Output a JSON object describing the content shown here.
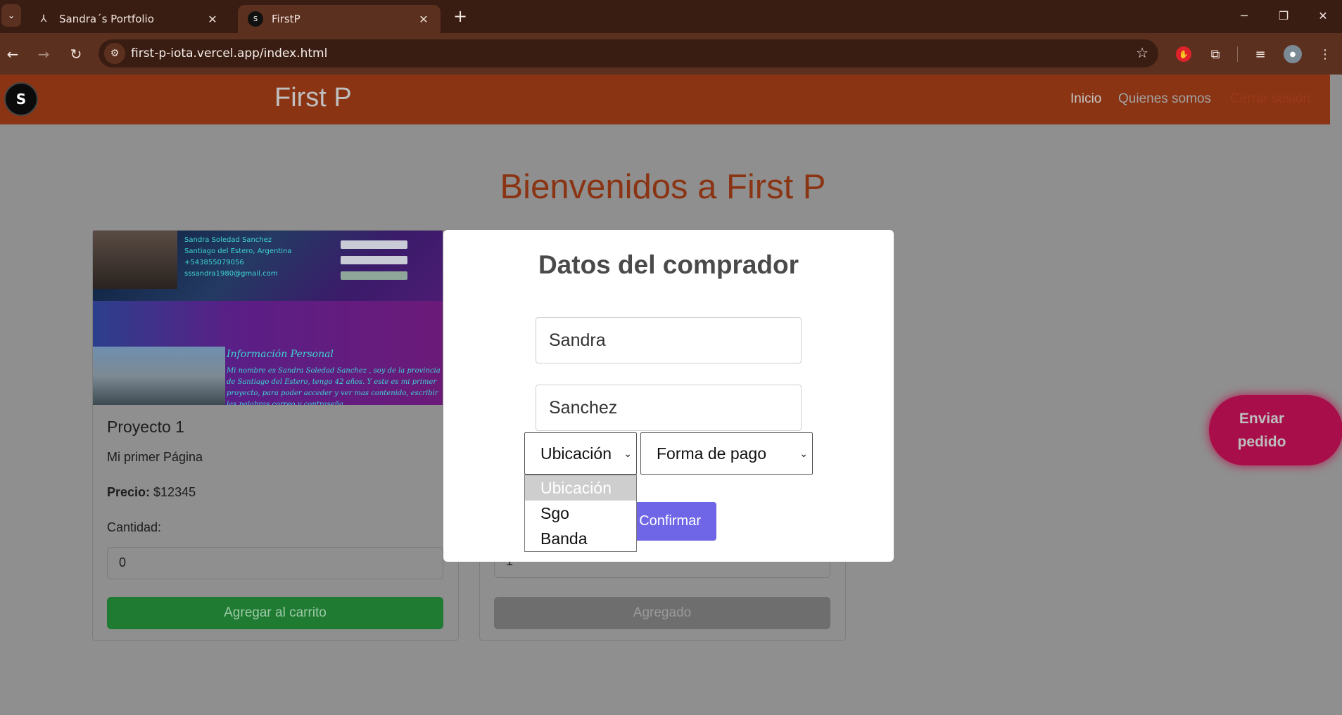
{
  "browser": {
    "tabs": [
      {
        "title": "Sandra´s Portfolio",
        "icon": "person-icon"
      },
      {
        "title": "FirstP",
        "icon": "site-logo-icon"
      }
    ],
    "url": "first-p-iota.vercel.app/index.html"
  },
  "site": {
    "logo_text": "S",
    "brand": "First P",
    "nav": {
      "inicio": "Inicio",
      "quienes": "Quienes somos",
      "cerrar": "Cerrar sesión"
    },
    "welcome": "Bienvenidos a First P"
  },
  "cards": [
    {
      "title": "Proyecto 1",
      "subtitle": "Mi primer Página",
      "price_label": "Precio:",
      "price_value": " $12345",
      "qty_label": "Cantidad:",
      "qty_value": "0",
      "button": "Agregar al carrito",
      "img": {
        "lines": [
          "Sandra Soledad Sanchez",
          "Santiago del Estero, Argentina",
          "+543855079056",
          "sssandra1980@gmail.com"
        ],
        "info_title": "Información Personal",
        "info_text": "Mi nombre es Sandra Soledad Sanchez , soy de la provincia de Santiago del Estero, tengo 42 años. Y este es mi primer proyecto, para poder acceder y ver mas contenido, escribir las palabras correo y contraseña"
      }
    },
    {
      "qty_value": "1",
      "button": "Agregado"
    }
  ],
  "enviar": {
    "line1": "Enviar",
    "line2": "pedido"
  },
  "modal": {
    "title": "Datos del comprador",
    "nombre": "Sandra",
    "apellido": "Sanchez",
    "ubicacion": "Ubicación",
    "forma_pago": "Forma de pago",
    "confirm": "Confirmar",
    "ubicacion_options": [
      "Ubicación",
      "Sgo",
      "Banda"
    ]
  }
}
